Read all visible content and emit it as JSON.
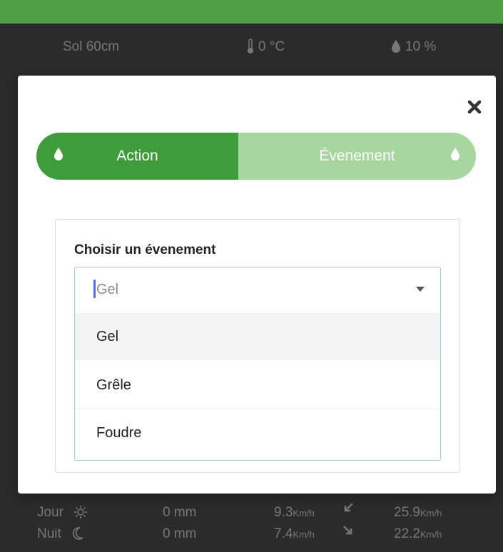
{
  "background": {
    "header_row": {
      "label": "Sol 60cm",
      "temperature": "0 °C",
      "humidity": "10 %"
    },
    "rows": [
      {
        "label": "Jour",
        "rain": "0 mm",
        "wind_value": "9.3",
        "wind_unit": "Km/h",
        "gust_value": "25.9",
        "gust_unit": "Km/h"
      },
      {
        "label": "Nuit",
        "rain": "0 mm",
        "wind_value": "7.4",
        "wind_unit": "Km/h",
        "gust_value": "22.2",
        "gust_unit": "Km/h"
      }
    ]
  },
  "modal": {
    "toggle": {
      "left_label": "Action",
      "right_label": "Évenement"
    },
    "form": {
      "label": "Choisir un évenement",
      "selected_value": "Gel",
      "options": [
        "Gel",
        "Grêle",
        "Foudre"
      ]
    }
  },
  "colors": {
    "brand_green": "#3f9c3a",
    "light_green": "#a7d69f",
    "focus_border": "#9ecdd6"
  }
}
